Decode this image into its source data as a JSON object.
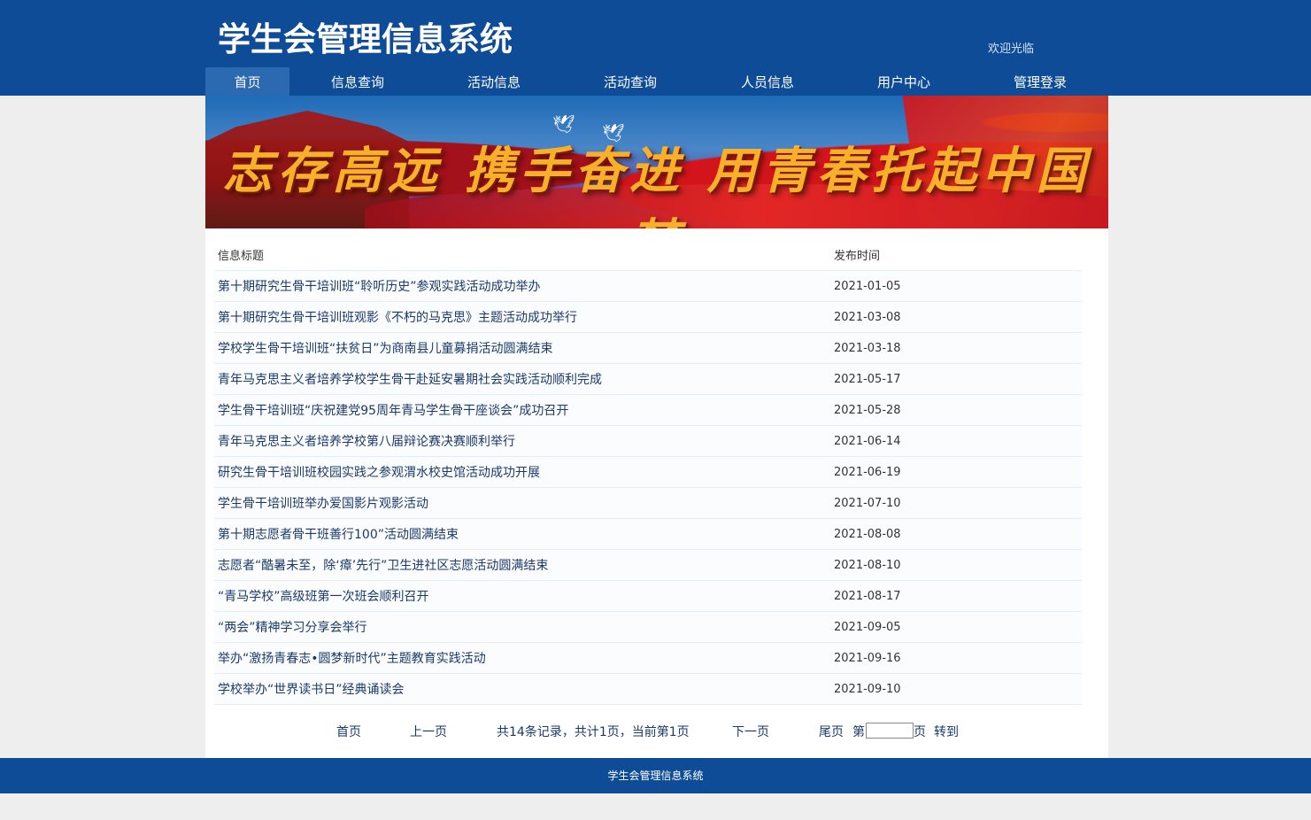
{
  "header": {
    "site_title": "学生会管理信息系统",
    "welcome": "欢迎光临"
  },
  "nav": {
    "items": [
      {
        "label": "首页",
        "active": true
      },
      {
        "label": "信息查询"
      },
      {
        "label": "活动信息"
      },
      {
        "label": "活动查询"
      },
      {
        "label": "人员信息"
      },
      {
        "label": "用户中心"
      },
      {
        "label": "管理登录"
      }
    ]
  },
  "banner": {
    "slogan": "志存高远  携手奋进  用青春托起中国梦"
  },
  "table": {
    "headers": {
      "title": "信息标题",
      "date": "发布时间"
    },
    "rows": [
      {
        "title": "第十期研究生骨干培训班“聆听历史”参观实践活动成功举办",
        "date": "2021-01-05"
      },
      {
        "title": "第十期研究生骨干培训班观影《不朽的马克思》主题活动成功举行",
        "date": "2021-03-08"
      },
      {
        "title": "学校学生骨干培训班“扶贫日”为商南县儿童募捐活动圆满结束",
        "date": "2021-03-18"
      },
      {
        "title": "青年马克思主义者培养学校学生骨干赴延安暑期社会实践活动顺利完成",
        "date": "2021-05-17"
      },
      {
        "title": "学生骨干培训班“庆祝建党95周年青马学生骨干座谈会”成功召开",
        "date": "2021-05-28"
      },
      {
        "title": "青年马克思主义者培养学校第八届辩论赛决赛顺利举行",
        "date": "2021-06-14"
      },
      {
        "title": "研究生骨干培训班校园实践之参观渭水校史馆活动成功开展",
        "date": "2021-06-19"
      },
      {
        "title": "学生骨干培训班举办爱国影片观影活动",
        "date": "2021-07-10"
      },
      {
        "title": "第十期志愿者骨干班善行100”活动圆满结束",
        "date": "2021-08-08"
      },
      {
        "title": "志愿者“酷暑未至，除‘瘴’先行”卫生进社区志愿活动圆满结束",
        "date": "2021-08-10"
      },
      {
        "title": "“青马学校”高级班第一次班会顺利召开",
        "date": "2021-08-17"
      },
      {
        "title": "“两会”精神学习分享会举行",
        "date": "2021-09-05"
      },
      {
        "title": "举办“激扬青春志•圆梦新时代”主题教育实践活动",
        "date": "2021-09-16"
      },
      {
        "title": "学校举办“世界读书日”经典诵读会",
        "date": "2021-09-10"
      }
    ]
  },
  "pager": {
    "first": "首页",
    "prev": "上一页",
    "info": "共14条记录，共计1页，当前第1页",
    "next": "下一页",
    "last": "尾页",
    "page_prefix": "第",
    "page_input_value": "",
    "page_suffix": "页",
    "go": "转到"
  },
  "footer": {
    "text": "学生会管理信息系统"
  },
  "colors": {
    "brand_blue": "#0f4c97",
    "nav_active": "#2b69b0",
    "page_bg": "#eeeeee"
  }
}
